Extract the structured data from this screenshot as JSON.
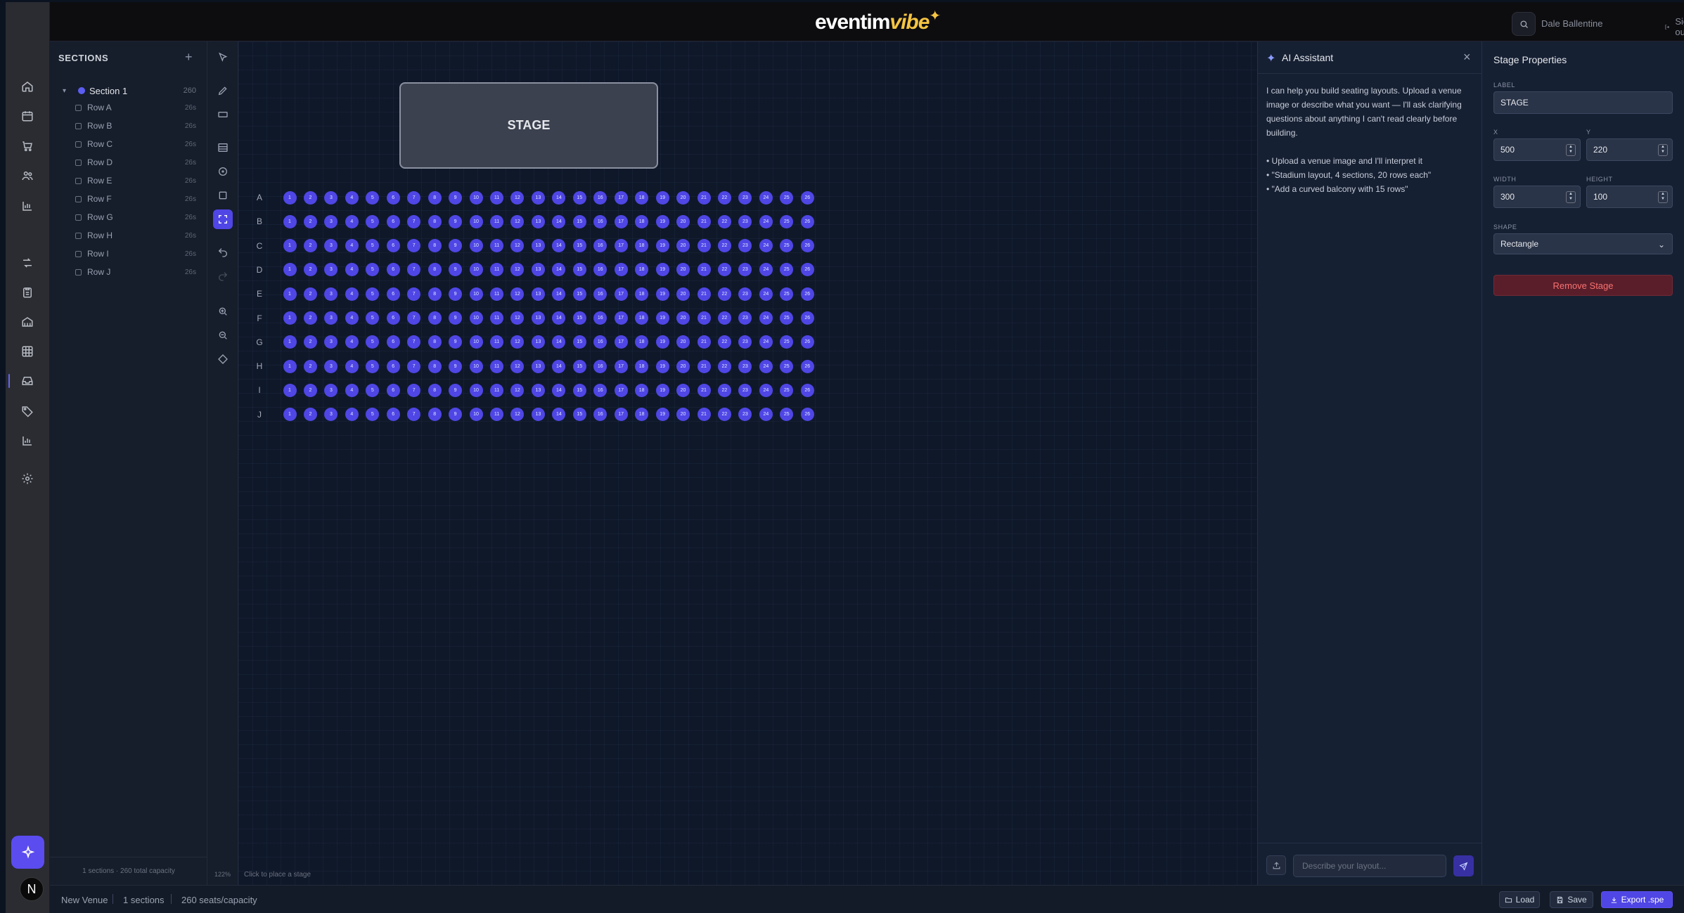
{
  "app": {
    "logo_main": "eventim",
    "logo_accent": "vibe",
    "user_name": "Dale Ballentine",
    "sign_out": "Sign out"
  },
  "sections_panel": {
    "title": "SECTIONS",
    "section": {
      "name": "Section 1",
      "count": "260",
      "color": "#5b5ef0"
    },
    "rows": [
      {
        "label": "Row A",
        "count": "26s"
      },
      {
        "label": "Row B",
        "count": "26s"
      },
      {
        "label": "Row C",
        "count": "26s"
      },
      {
        "label": "Row D",
        "count": "26s"
      },
      {
        "label": "Row E",
        "count": "26s"
      },
      {
        "label": "Row F",
        "count": "26s"
      },
      {
        "label": "Row G",
        "count": "26s"
      },
      {
        "label": "Row H",
        "count": "26s"
      },
      {
        "label": "Row I",
        "count": "26s"
      },
      {
        "label": "Row J",
        "count": "26s"
      }
    ],
    "footer": "1 sections · 260 total capacity"
  },
  "tools": {
    "items": [
      "select-icon",
      "pen-icon",
      "rectangle-icon",
      "rows-icon",
      "circle-icon",
      "square-icon",
      "stage-icon",
      "undo-icon",
      "redo-icon",
      "zoom-in-icon",
      "zoom-out-icon",
      "fit-icon"
    ],
    "active": "stage-icon",
    "zoom": "122%"
  },
  "canvas": {
    "stage_label": "STAGE",
    "row_labels": [
      "A",
      "B",
      "C",
      "D",
      "E",
      "F",
      "G",
      "H",
      "I",
      "J"
    ],
    "seats_per_row": 26,
    "hint": "Click to place a stage",
    "seat_color": "#4f46e5"
  },
  "ai_assistant": {
    "title": "AI Assistant",
    "intro": "I can help you build seating layouts. Upload a venue image or describe what you want — I'll ask clarifying questions about anything I can't read clearly before building.",
    "bullets": [
      "• Upload a venue image and I'll interpret it",
      "• \"Stadium layout, 4 sections, 20 rows each\"",
      "• \"Add a curved balcony with 15 rows\""
    ],
    "input_placeholder": "Describe your layout..."
  },
  "stage_properties": {
    "title": "Stage Properties",
    "label_caption": "LABEL",
    "label_value": "STAGE",
    "x_caption": "X",
    "x_value": "500",
    "y_caption": "Y",
    "y_value": "220",
    "width_caption": "WIDTH",
    "width_value": "300",
    "height_caption": "HEIGHT",
    "height_value": "100",
    "shape_caption": "SHAPE",
    "shape_value": "Rectangle",
    "remove_label": "Remove Stage"
  },
  "status_bar": {
    "venue": "New Venue",
    "sections": "1 sections",
    "capacity": "260 seats/capacity",
    "load": "Load",
    "save": "Save",
    "export": "Export .spe"
  }
}
